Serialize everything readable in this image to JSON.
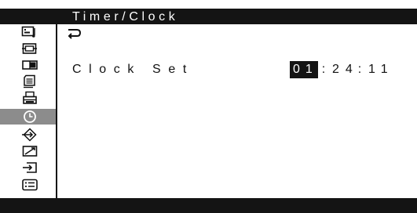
{
  "title": "Timer/Clock",
  "sidebar": {
    "items": [
      {
        "icon": "picture-sound-icon"
      },
      {
        "icon": "screen-icon"
      },
      {
        "icon": "pip-icon"
      },
      {
        "icon": "memory-card-icon"
      },
      {
        "icon": "multi-device-icon"
      },
      {
        "icon": "clock-icon",
        "selected": true
      },
      {
        "icon": "network-icon"
      },
      {
        "icon": "picture-adjust-icon"
      },
      {
        "icon": "input-icon"
      },
      {
        "icon": "menu-list-icon"
      }
    ]
  },
  "content": {
    "back_icon": "return-arrow-icon",
    "clock_set_label": "Clock Set",
    "time": {
      "hours": "01",
      "sep1": ":",
      "minutes": "24",
      "sep2": ":",
      "seconds": "11"
    }
  },
  "colors": {
    "bar": "#141414",
    "selected": "#8c8c8c",
    "background": "#ffffff"
  }
}
